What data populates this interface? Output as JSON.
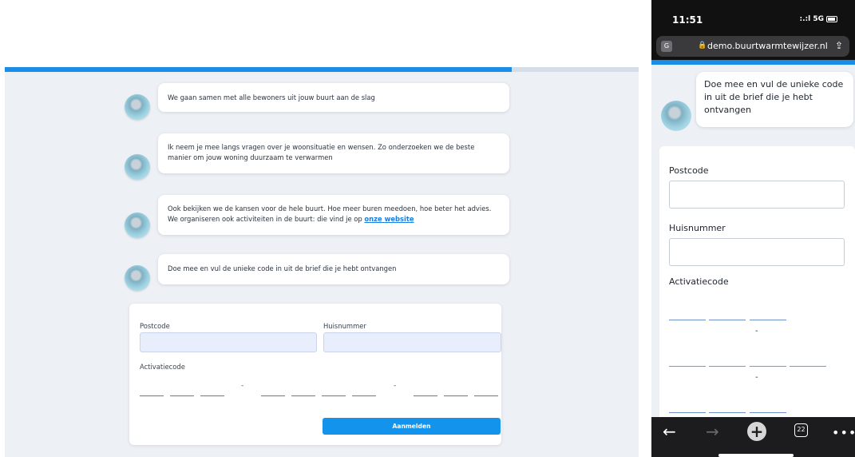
{
  "progress": {
    "desktop_fraction": 0.8,
    "phone_fraction": 1.0
  },
  "chat": {
    "messages": [
      {
        "lines": [
          "We gaan samen met alle bewoners uit jouw buurt aan de slag"
        ]
      },
      {
        "lines": [
          "Ik neem je mee langs vragen over je woonsituatie en wensen. Zo onderzoeken we de beste",
          "manier om jouw woning duurzaam te verwarmen"
        ]
      },
      {
        "lines": [
          "Ook bekijken we de kansen voor de hele buurt. Hoe meer buren meedoen, hoe beter het advies.",
          "We organiseren ook activiteiten in de buurt: die vind je op "
        ],
        "link": "onze website"
      },
      {
        "lines": [
          "Doe mee en vul de unieke code in uit de brief die je hebt ontvangen"
        ]
      }
    ]
  },
  "form": {
    "postcode_label": "Postcode",
    "postcode_value": "",
    "huisnummer_label": "Huisnummer",
    "huisnummer_value": "",
    "activatiecode_label": "Activatiecode",
    "separator": "-",
    "submit_label": "Aanmelden"
  },
  "phone": {
    "time": "11:51",
    "signal": "5G",
    "url": "demo.buurtwarmtewijzer.nl",
    "bubble_text": "Doe mee en vul de unieke code in uit de brief die je hebt ontvangen",
    "tab_count": "22"
  },
  "colors": {
    "accent": "#1493ec",
    "background": "#edf1f6"
  }
}
